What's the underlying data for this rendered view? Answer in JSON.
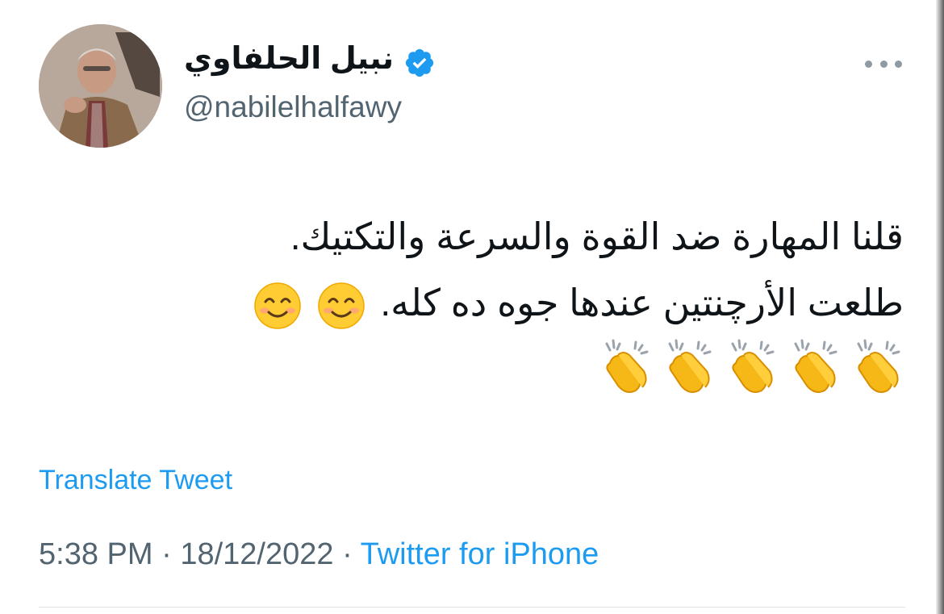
{
  "tweet": {
    "author": {
      "name": "نبيل الحلفاوي",
      "handle": "@nabilelhalfawy",
      "verified": true,
      "avatar_icon": "profile-photo"
    },
    "text_lines": [
      "قلنا المهارة ضد القوة والسرعة والتكتيك.",
      "طلعت الأرچنتين عندها جوه ده كله."
    ],
    "emojis": {
      "smile_icon": "smiling-face-with-smiling-eyes",
      "smile_count": 2,
      "clap_icon": "clapping-hands",
      "clap_count": 5
    },
    "translate_label": "Translate Tweet",
    "time": "5:38 PM",
    "separator": "·",
    "date": "18/12/2022",
    "source": "Twitter for iPhone",
    "more_icon": "more-horizontal-icon"
  },
  "colors": {
    "link_blue": "#1d9bf0",
    "secondary_gray": "#536471",
    "text": "#0f1419",
    "verified_blue": "#1d9bf0"
  }
}
